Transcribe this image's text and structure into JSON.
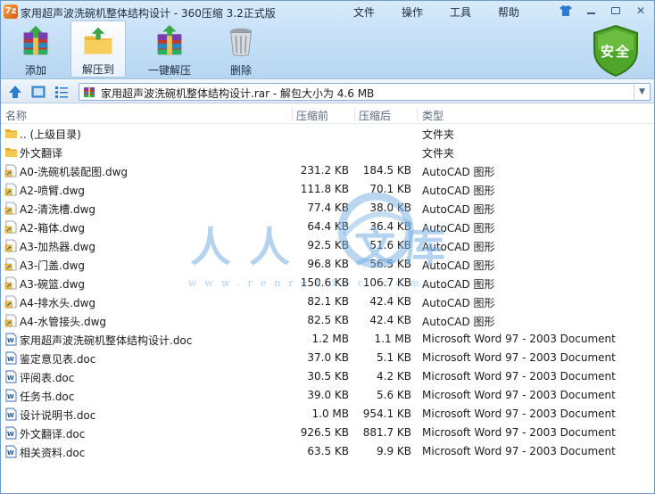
{
  "window": {
    "title": "家用超声波洗碗机整体结构设计 - 360压缩 3.2正式版"
  },
  "menu": [
    "文件",
    "操作",
    "工具",
    "帮助"
  ],
  "toolbar": {
    "add": "添加",
    "extract": "解压到",
    "one_click_extract": "一键解压",
    "delete": "删除"
  },
  "security_badge": "安全",
  "address": {
    "text": "家用超声波洗碗机整体结构设计.rar - 解包大小为 4.6 MB"
  },
  "columns": {
    "name": "名称",
    "size": "压缩前",
    "packed": "压缩后",
    "type": "类型"
  },
  "files": [
    {
      "icon": "folder-up-icon",
      "name": ".. (上级目录)",
      "size": "",
      "packed": "",
      "type": "文件夹"
    },
    {
      "icon": "folder-icon",
      "name": "外文翻译",
      "size": "",
      "packed": "",
      "type": "文件夹"
    },
    {
      "icon": "dwg-file-icon",
      "name": "A0-洗碗机装配图.dwg",
      "size": "231.2 KB",
      "packed": "184.5 KB",
      "type": "AutoCAD 图形"
    },
    {
      "icon": "dwg-file-icon",
      "name": "A2-喷臂.dwg",
      "size": "111.8 KB",
      "packed": "70.1 KB",
      "type": "AutoCAD 图形"
    },
    {
      "icon": "dwg-file-icon",
      "name": "A2-清洗槽.dwg",
      "size": "77.4 KB",
      "packed": "38.0 KB",
      "type": "AutoCAD 图形"
    },
    {
      "icon": "dwg-file-icon",
      "name": "A2-箱体.dwg",
      "size": "64.4 KB",
      "packed": "36.4 KB",
      "type": "AutoCAD 图形"
    },
    {
      "icon": "dwg-file-icon",
      "name": "A3-加热器.dwg",
      "size": "92.5 KB",
      "packed": "51.6 KB",
      "type": "AutoCAD 图形"
    },
    {
      "icon": "dwg-file-icon",
      "name": "A3-门盖.dwg",
      "size": "96.8 KB",
      "packed": "56.5 KB",
      "type": "AutoCAD 图形"
    },
    {
      "icon": "dwg-file-icon",
      "name": "A3-碗篮.dwg",
      "size": "150.6 KB",
      "packed": "106.7 KB",
      "type": "AutoCAD 图形"
    },
    {
      "icon": "dwg-file-icon",
      "name": "A4-排水头.dwg",
      "size": "82.1 KB",
      "packed": "42.4 KB",
      "type": "AutoCAD 图形"
    },
    {
      "icon": "dwg-file-icon",
      "name": "A4-水管接头.dwg",
      "size": "82.5 KB",
      "packed": "42.4 KB",
      "type": "AutoCAD 图形"
    },
    {
      "icon": "word-doc-icon",
      "name": "家用超声波洗碗机整体结构设计.doc",
      "size": "1.2 MB",
      "packed": "1.1 MB",
      "type": "Microsoft Word 97 - 2003 Document"
    },
    {
      "icon": "word-doc-icon",
      "name": "鉴定意见表.doc",
      "size": "37.0 KB",
      "packed": "5.1 KB",
      "type": "Microsoft Word 97 - 2003 Document"
    },
    {
      "icon": "word-doc-icon",
      "name": "评阅表.doc",
      "size": "30.5 KB",
      "packed": "4.2 KB",
      "type": "Microsoft Word 97 - 2003 Document"
    },
    {
      "icon": "word-doc-icon",
      "name": "任务书.doc",
      "size": "39.0 KB",
      "packed": "5.6 KB",
      "type": "Microsoft Word 97 - 2003 Document"
    },
    {
      "icon": "word-doc-icon",
      "name": "设计说明书.doc",
      "size": "1.0 MB",
      "packed": "954.1 KB",
      "type": "Microsoft Word 97 - 2003 Document"
    },
    {
      "icon": "word-doc-icon",
      "name": "外文翻译.doc",
      "size": "926.5 KB",
      "packed": "881.7 KB",
      "type": "Microsoft Word 97 - 2003 Document"
    },
    {
      "icon": "word-doc-icon",
      "name": "相关资料.doc",
      "size": "63.5 KB",
      "packed": "9.9 KB",
      "type": "Microsoft Word 97 - 2003 Document"
    }
  ],
  "watermark": {
    "chars": [
      "人",
      "人",
      "文",
      "库"
    ],
    "url": "www.renrendoc.com"
  },
  "colors": {
    "accent": "#2b7bd0",
    "shield": "#4ea52a",
    "folder": "#f2c04d"
  }
}
